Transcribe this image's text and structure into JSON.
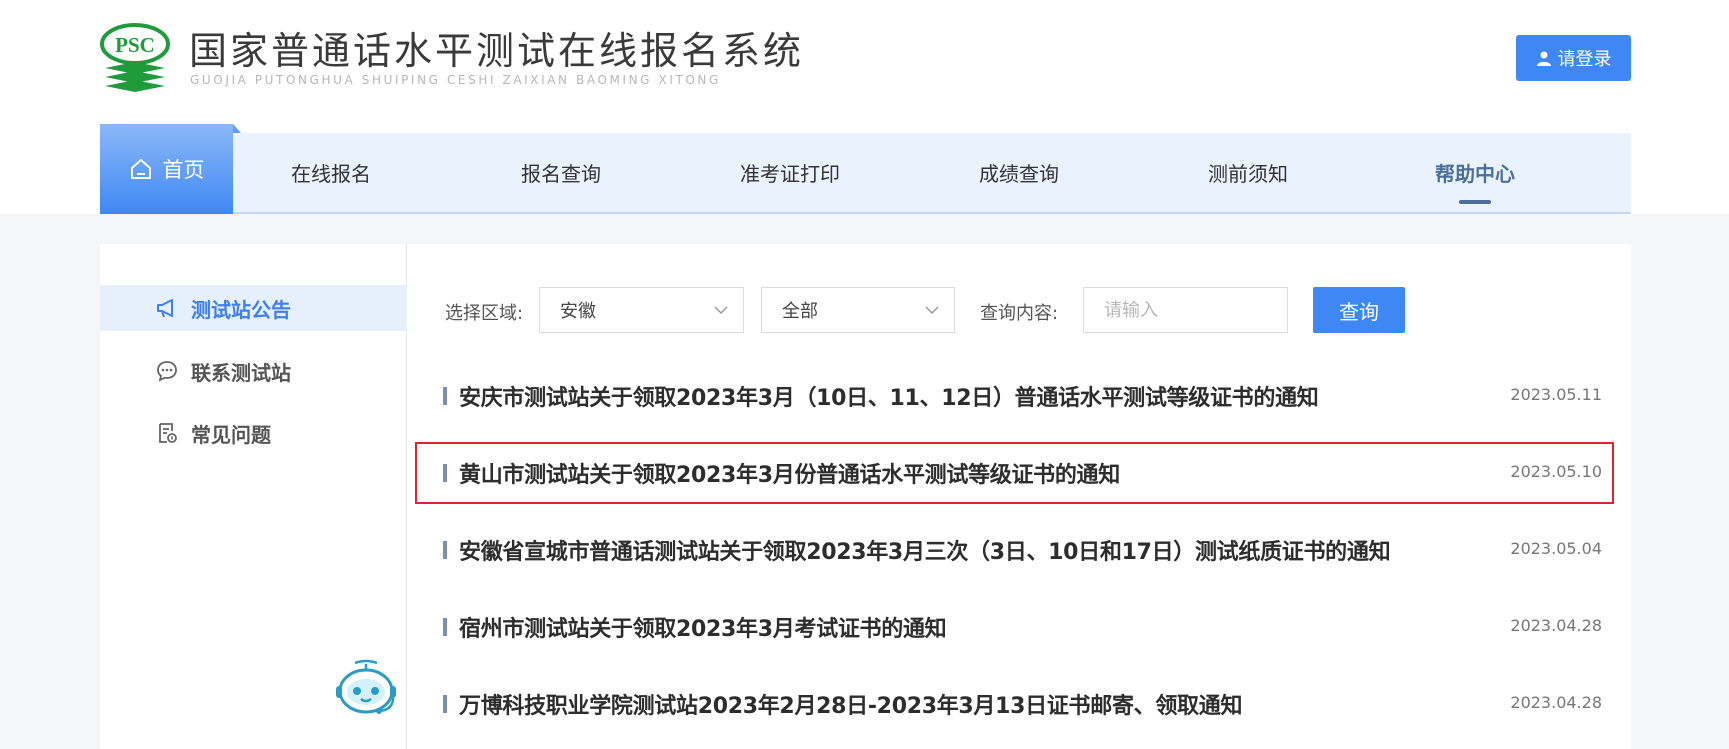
{
  "header": {
    "logo_text": "PSC",
    "site_title": "国家普通话水平测试在线报名系统",
    "site_subtitle": "GUOJIA PUTONGHUA SHUIPING CESHI ZAIXIAN BAOMING XITONG",
    "login_label": "请登录",
    "accent_color": "#3e87f5"
  },
  "nav": {
    "home": "首页",
    "items": [
      {
        "label": "在线报名"
      },
      {
        "label": "报名查询"
      },
      {
        "label": "准考证打印"
      },
      {
        "label": "成绩查询"
      },
      {
        "label": "测前须知"
      },
      {
        "label": "帮助中心"
      }
    ],
    "active_label": "帮助中心"
  },
  "sidebar": {
    "items": [
      {
        "label": "测试站公告",
        "icon": "megaphone-icon",
        "active": true
      },
      {
        "label": "联系测试站",
        "icon": "chat-bubble-icon",
        "active": false
      },
      {
        "label": "常见问题",
        "icon": "faq-document-icon",
        "active": false
      }
    ]
  },
  "filters": {
    "region_label": "选择区域:",
    "region_value": "安徽",
    "scope_value": "全部",
    "query_label": "查询内容:",
    "query_placeholder": "请输入",
    "query_button": "查询"
  },
  "news": [
    {
      "title": "安庆市测试站关于领取2023年3月（10日、11、12日）普通话水平测试等级证书的通知",
      "date": "2023.05.11"
    },
    {
      "title": "黄山市测试站关于领取2023年3月份普通话水平测试等级证书的通知",
      "date": "2023.05.10",
      "highlighted": true
    },
    {
      "title": "安徽省宣城市普通话测试站关于领取2023年3月三次（3日、10日和17日）测试纸质证书的通知",
      "date": "2023.05.04"
    },
    {
      "title": "宿州市测试站关于领取2023年3月考试证书的通知",
      "date": "2023.04.28"
    },
    {
      "title": "万博科技职业学院测试站2023年2月28日-2023年3月13日证书邮寄、领取通知",
      "date": "2023.04.28"
    }
  ]
}
